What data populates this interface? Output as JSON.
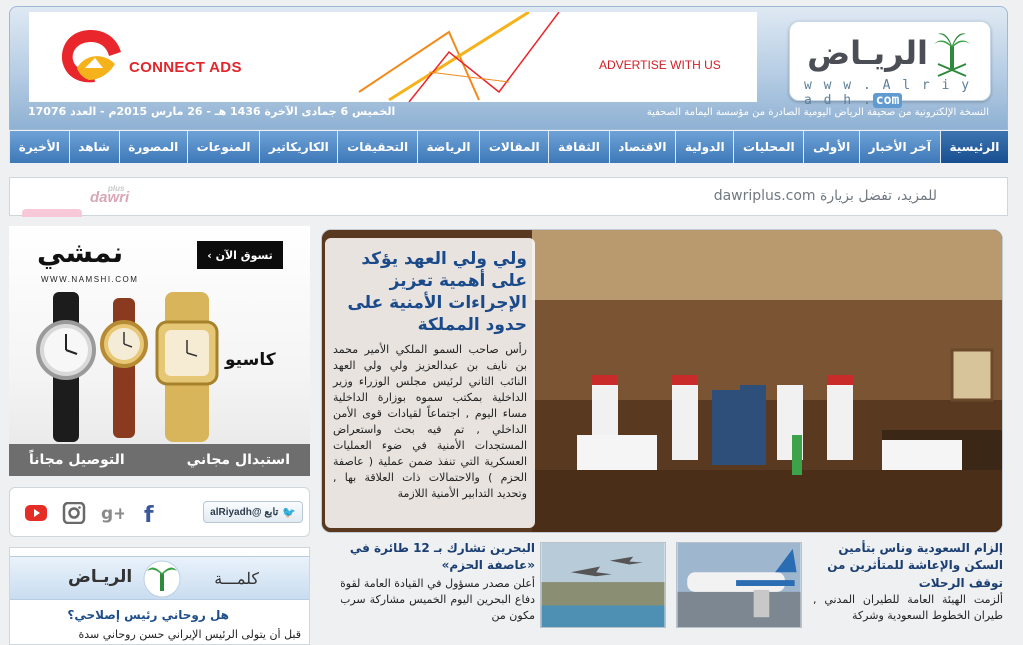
{
  "header": {
    "ad": {
      "brand": "CONNECT ADS",
      "cta": "ADVERTISE WITH US"
    },
    "logo": {
      "arabic": "الريـاض",
      "latin_prefix": "w w w . A l r i y a d h .",
      "latin_suffix": "com"
    },
    "date_line": "الخميس 6 جمادى الآخرة 1436 هـ - 26 مارس 2015م - العدد 17076",
    "tagline": "النسخة الإلكترونية من صحيفة الرياض اليومية الصادرة من مؤسسة اليمامة الصحفية"
  },
  "nav": {
    "items": [
      {
        "label": "الرئيسية",
        "active": true
      },
      {
        "label": "آخر الأخبار"
      },
      {
        "label": "الأولى"
      },
      {
        "label": "المحليات"
      },
      {
        "label": "الدولية"
      },
      {
        "label": "الاقتصاد"
      },
      {
        "label": "الثقافة"
      },
      {
        "label": "المقالات"
      },
      {
        "label": "الرياضة"
      },
      {
        "label": "التحقيقات"
      },
      {
        "label": "الكاريكاتير"
      },
      {
        "label": "المنوعات"
      },
      {
        "label": "المصورة"
      },
      {
        "label": "شاهد"
      },
      {
        "label": "الأخيرة"
      }
    ]
  },
  "promo": {
    "text": "للمزيد، تفضل بزيارة dawriplus.com",
    "logo": "dawri",
    "logo_small": "plus"
  },
  "namshi_ad": {
    "logo": "نمشي",
    "url": "WWW.NAMSHI.COM",
    "shop_now": "تسوق الآن ›",
    "brand": "كاسيو",
    "footer_right": "استبدال مجاني",
    "footer_left": "التوصيل مجاناً"
  },
  "social": {
    "follow_text": "تابع @alRiyadh",
    "icons": [
      "facebook-icon",
      "google-plus-icon",
      "instagram-icon",
      "youtube-icon"
    ],
    "colors": {
      "facebook": "#3b5998",
      "google": "#8a8a8a",
      "instagram": "#6a6a6a",
      "youtube": "#e52d27"
    }
  },
  "kalima": {
    "label": "كلمـــة",
    "brand": "الريـاض",
    "title": "هل روحاني رئيس إصلاحي؟",
    "snippet": "قبل أن يتولى الرئيس الإيراني حسن روحاني سدة"
  },
  "featured": {
    "title": "ولي ولي العهد يؤكد على أهمية تعزيز الإجراءات الأمنية على حدود المملكة",
    "body": "رأس صاحب السمو الملكي الأمير محمد بن نايف بن عبدالعزيز ولي ولي العهد النائب الثاني لرئيس مجلس الوزراء وزير الداخلية بمكتب سموه بوزارة الداخلية مساء اليوم , اجتماعاً لقيادات قوى الأمن الداخلي , تم فيه بحث واستعراض المستجدات الأمنية في ضوء العمليات العسكرية التي تنفذ ضمن عملية ( عاصفة الحزم ) والاحتمالات ذات العلاقة بها , وتحديد التدابير الأمنية اللازمة"
  },
  "stories": [
    {
      "title": "إلزام السعودية وناس بتأمين السكن والإعاشة للمتأثرين من توقف الرحلات",
      "body": "ألزمت الهيئة العامة للطيران المدني , طيران الخطوط السعودية وشركة"
    },
    {
      "title": "البحرين تشارك بـ 12 طائرة في «عاصفة الحزم»",
      "body": "أعلن مصدر مسؤول في القيادة العامة لقوة دفاع البحرين اليوم الخميس مشاركة سرب مكون من"
    }
  ],
  "colors": {
    "nav": "#3d78b8",
    "nav_active": "#174f91",
    "headline": "#1b4a8a",
    "accent_red": "#e2262b"
  }
}
